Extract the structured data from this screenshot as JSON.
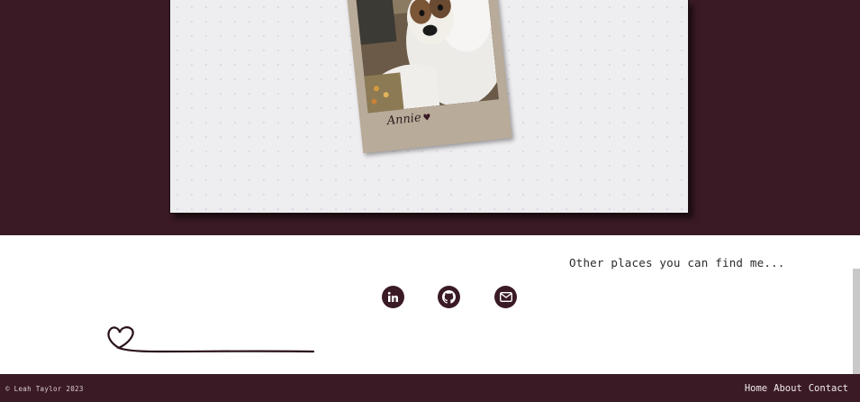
{
  "hero": {
    "polaroid_caption": "Annie",
    "photo_alt": "dog-photo"
  },
  "social": {
    "heading": "Other places you can find me...",
    "links": [
      {
        "name": "linkedin",
        "icon": "linkedin-icon"
      },
      {
        "name": "github",
        "icon": "github-icon"
      },
      {
        "name": "email",
        "icon": "mail-icon"
      }
    ]
  },
  "footer": {
    "copyright": "© Leah Taylor 2023",
    "nav": [
      "Home",
      "About",
      "Contact"
    ]
  },
  "colors": {
    "brand": "#3a1a25",
    "paper": "#eeedf0",
    "polaroid": "#b9ab99"
  }
}
